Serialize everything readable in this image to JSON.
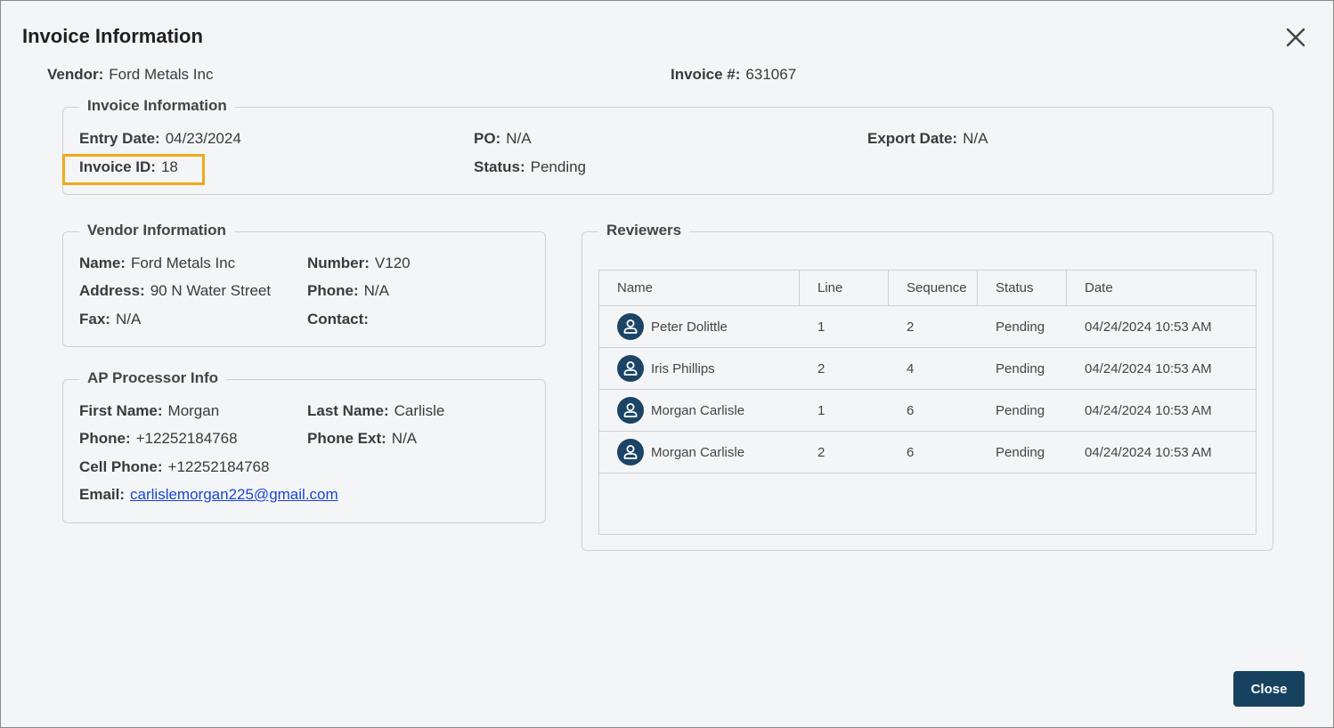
{
  "dialog": {
    "title": "Invoice Information",
    "close_button": "Close"
  },
  "header": {
    "vendor_label": "Vendor:",
    "vendor_value": "Ford Metals Inc",
    "invoice_num_label": "Invoice #:",
    "invoice_num_value": "631067"
  },
  "invoice_info": {
    "legend": "Invoice Information",
    "entry_date_label": "Entry Date:",
    "entry_date_value": "04/23/2024",
    "invoice_id_label": "Invoice ID:",
    "invoice_id_value": "18",
    "po_label": "PO:",
    "po_value": "N/A",
    "status_label": "Status:",
    "status_value": "Pending",
    "export_date_label": "Export Date:",
    "export_date_value": "N/A"
  },
  "vendor_info": {
    "legend": "Vendor Information",
    "name_label": "Name:",
    "name_value": "Ford Metals Inc",
    "number_label": "Number:",
    "number_value": "V120",
    "address_label": "Address:",
    "address_value": "90 N Water Street",
    "phone_label": "Phone:",
    "phone_value": "N/A",
    "fax_label": "Fax:",
    "fax_value": "N/A",
    "contact_label": "Contact:",
    "contact_value": ""
  },
  "ap_processor": {
    "legend": "AP Processor Info",
    "first_name_label": "First Name:",
    "first_name_value": "Morgan",
    "last_name_label": "Last Name:",
    "last_name_value": "Carlisle",
    "phone_label": "Phone:",
    "phone_value": "+12252184768",
    "phone_ext_label": "Phone Ext:",
    "phone_ext_value": "N/A",
    "cell_phone_label": "Cell Phone:",
    "cell_phone_value": "+12252184768",
    "email_label": "Email:",
    "email_value": "carlislemorgan225@gmail.com"
  },
  "reviewers": {
    "legend": "Reviewers",
    "columns": [
      "Name",
      "Line",
      "Sequence",
      "Status",
      "Date"
    ],
    "rows": [
      {
        "name": "Peter Dolittle",
        "line": "1",
        "sequence": "2",
        "status": "Pending",
        "date": "04/24/2024 10:53 AM"
      },
      {
        "name": "Iris Phillips",
        "line": "2",
        "sequence": "4",
        "status": "Pending",
        "date": "04/24/2024 10:53 AM"
      },
      {
        "name": "Morgan Carlisle",
        "line": "1",
        "sequence": "6",
        "status": "Pending",
        "date": "04/24/2024 10:53 AM"
      },
      {
        "name": "Morgan Carlisle",
        "line": "2",
        "sequence": "6",
        "status": "Pending",
        "date": "04/24/2024 10:53 AM"
      }
    ]
  },
  "colors": {
    "accent": "#17425f",
    "highlight": "#f0a91b",
    "avatar": "#1b4466",
    "link": "#1a44d6"
  },
  "icons": {
    "close": "close-icon",
    "avatar": "user-avatar-icon"
  }
}
